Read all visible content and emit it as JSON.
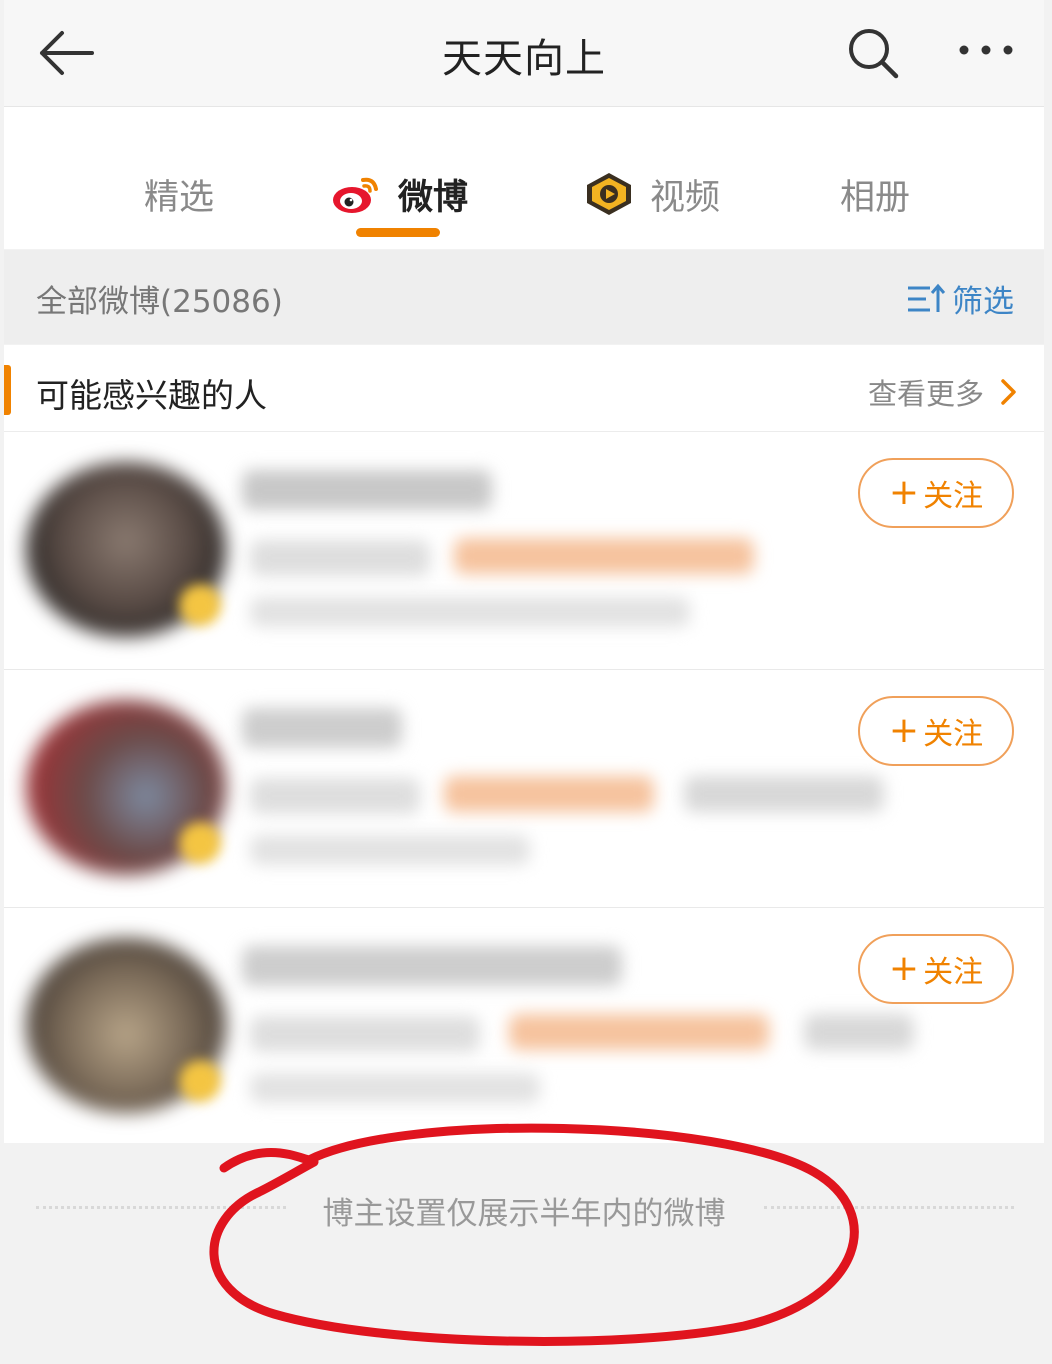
{
  "nav": {
    "title": "天天向上",
    "back_icon": "back-arrow-icon",
    "search_icon": "search-icon",
    "more_icon": "more-dots-icon"
  },
  "tabs": [
    {
      "label": "精选",
      "active": false
    },
    {
      "label": "微博",
      "active": true,
      "icon": "weibo-logo-icon"
    },
    {
      "label": "视频",
      "active": false,
      "icon": "video-play-icon"
    },
    {
      "label": "相册",
      "active": false
    }
  ],
  "feed": {
    "count_label": "全部微博(25086)",
    "filter_label": "筛选",
    "filter_icon": "sort-filter-icon"
  },
  "recommend": {
    "title": "可能感兴趣的人",
    "more_label": "查看更多",
    "more_icon": "chevron-right-icon",
    "follow_label": "关注",
    "users": [
      {
        "blurred": true
      },
      {
        "blurred": true
      },
      {
        "blurred": true
      }
    ]
  },
  "footer": {
    "note": "博主设置仅展示半年内的微博"
  },
  "colors": {
    "accent": "#f08200",
    "link_blue": "#3d85c6",
    "annotation_red": "#e0141e"
  }
}
